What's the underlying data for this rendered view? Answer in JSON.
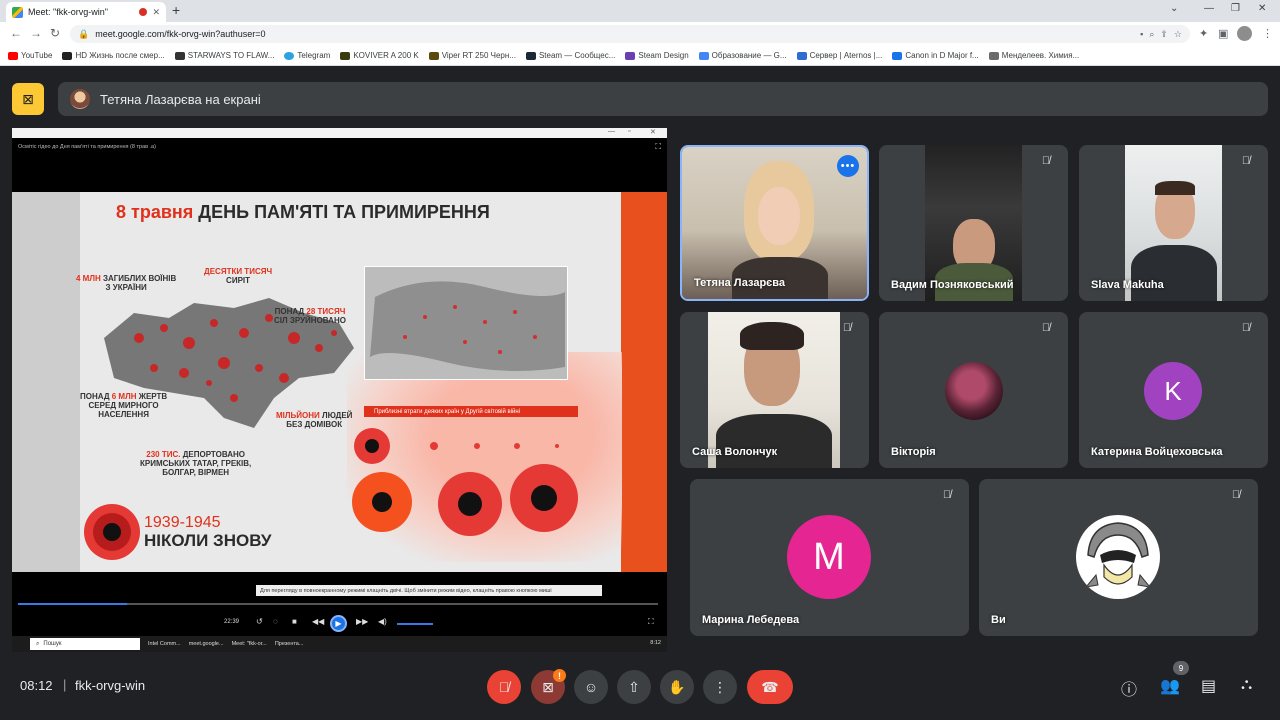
{
  "browser": {
    "tab_title": "Meet: \"fkk-orvg-win\"",
    "url": "meet.google.com/fkk-orvg-win?authuser=0",
    "bookmarks": [
      "YouTube",
      "HD Жизнь после смер...",
      "STARWAYS TO FLAW...",
      "Telegram",
      "KOVIVER A 200 K",
      "Viper RT 250 Черн...",
      "Steam — Сообщес...",
      "Steam Design",
      "Образование — G...",
      "Сервер | Aternos |...",
      "Canon in D Major f...",
      "Менделеев. Химия..."
    ]
  },
  "meet": {
    "presenting_text": "Тетяна Лазарєва на екрані",
    "time": "08:12",
    "separator": "|",
    "meeting_code": "fkk-orvg-win",
    "participant_count": "9"
  },
  "presentation": {
    "caption": "Осмітіс гідео до Дня пам'яті та примирення (8 трав .а)",
    "slide_title_date": "8 травня",
    "slide_title_rest": "ДЕНЬ ПАМ'ЯТІ ТА ПРИМИРЕННЯ",
    "stat_1_red": "4 МЛН",
    "stat_1_rest": " ЗАГИБЛИХ ВОЇНІВ\nЗ УКРАЇНИ",
    "stat_2_red": "ДЕСЯТКИ ТИСЯЧ",
    "stat_2_rest": "\nСИРІТ",
    "stat_3_start": "ПОНАД ",
    "stat_3_red": "28 ТИСЯЧ",
    "stat_3_rest": "\nСІЛ ЗРУЙНОВАНО",
    "stat_4_start": "ПОНАД ",
    "stat_4_red": "6 МЛН",
    "stat_4_rest": " ЖЕРТВ\nСЕРЕД МИРНОГО\nНАСЕЛЕННЯ",
    "stat_5_red": "МІЛЬЙОНИ",
    "stat_5_rest": " ЛЮДЕЙ\nБЕЗ ДОМІВОК",
    "stat_6_red": "230 ТИС.",
    "stat_6_rest": " ДЕПОРТОВАНО\nКРИМСЬКИХ ТАТАР, ГРЕКІВ,\nБОЛГАР, ВІРМЕН",
    "banner": "Приблизні втрати деяких країн у Другій світовій війні",
    "years": "1939-1945",
    "never_again": "НІКОЛИ ЗНОВУ",
    "subtitle": "Для перегляду в повноекранному режимі клацніть двічі. Щоб змінити режим відео, клацніть правою кнопкою миші",
    "player_time": "22:39",
    "taskbar_search": "Пошук",
    "taskbar_apps": [
      "Intel Comm...",
      "meet.google...",
      "",
      "Meet: \"fkk-or...",
      "Презента..."
    ],
    "taskbar_time": "8:12"
  },
  "participants": [
    {
      "name": "Тетяна Лазарєва",
      "muted": false,
      "active": true
    },
    {
      "name": "Вадим Позняковський",
      "muted": true
    },
    {
      "name": "Slava Makuha",
      "muted": true
    },
    {
      "name": "Саша Волончук",
      "muted": true
    },
    {
      "name": "Вікторія",
      "muted": true
    },
    {
      "name": "Катерина Войцеховська",
      "muted": true,
      "initial": "K",
      "color": "#a142c0"
    },
    {
      "name": "Марина Лебедева",
      "muted": true,
      "initial": "M",
      "color": "#e52592"
    },
    {
      "name": "Ви",
      "muted": true
    }
  ],
  "colors": {
    "accent_blue": "#1a73e8",
    "danger_red": "#ea4335",
    "present_yellow": "#fcc934",
    "tile_bg": "#3c4043",
    "page_bg": "#202124"
  }
}
